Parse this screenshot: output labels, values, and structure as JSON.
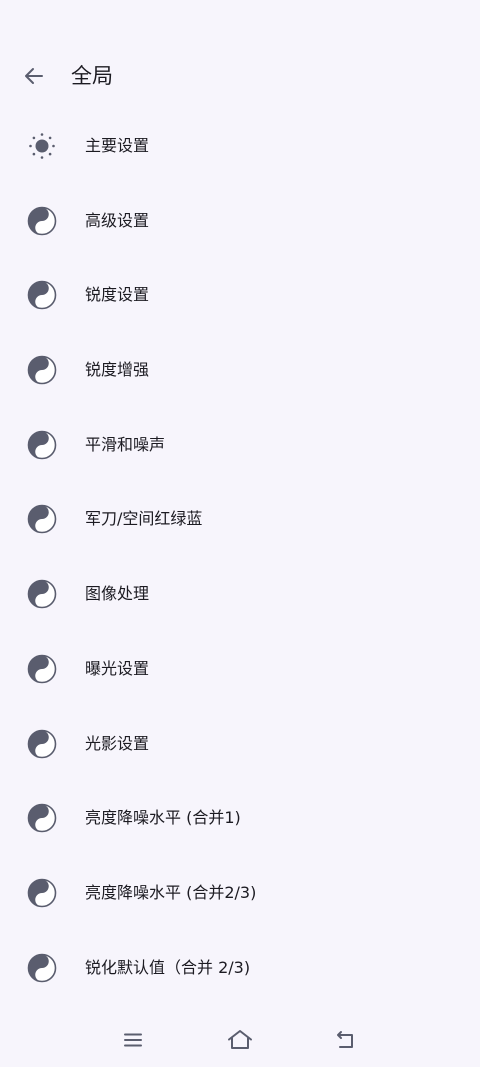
{
  "header": {
    "back_icon": "arrow-left-icon",
    "title": "全局"
  },
  "colors": {
    "background": "#f7f5fc",
    "icon": "#5a5d6e",
    "text": "#1c1b22"
  },
  "items": [
    {
      "label": "主要设置",
      "icon": "sun-icon"
    },
    {
      "label": "高级设置",
      "icon": "yin-yang-icon"
    },
    {
      "label": "锐度设置",
      "icon": "yin-yang-icon"
    },
    {
      "label": "锐度增强",
      "icon": "yin-yang-icon"
    },
    {
      "label": "平滑和噪声",
      "icon": "yin-yang-icon"
    },
    {
      "label": "军刀/空间红绿蓝",
      "icon": "yin-yang-icon"
    },
    {
      "label": "图像处理",
      "icon": "yin-yang-icon"
    },
    {
      "label": "曝光设置",
      "icon": "yin-yang-icon"
    },
    {
      "label": "光影设置",
      "icon": "yin-yang-icon"
    },
    {
      "label": "亮度降噪水平 (合并1)",
      "icon": "yin-yang-icon"
    },
    {
      "label": "亮度降噪水平 (合并2/3)",
      "icon": "yin-yang-icon"
    },
    {
      "label": "锐化默认值（合并 2/3)",
      "icon": "yin-yang-icon"
    }
  ],
  "nav": {
    "menu_icon": "menu-icon",
    "home_icon": "home-icon",
    "back_icon": "back-icon"
  }
}
